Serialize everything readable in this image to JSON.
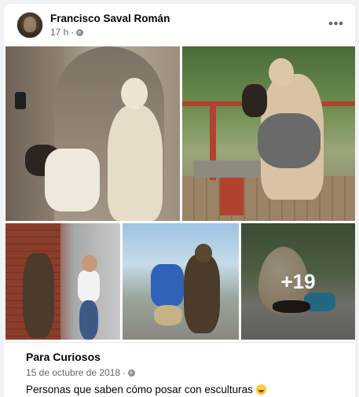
{
  "post": {
    "author": "Francisco Saval Román",
    "time": "17 h",
    "separator": "·",
    "more_label": "•••"
  },
  "photos": {
    "extra_count": "+19"
  },
  "link_preview": {
    "source": "Para Curiosos",
    "date": "15 de octubre de 2018",
    "separator": "·",
    "text": "Personas que saben cómo posar con esculturas",
    "emoji": "smiling-face-emoji"
  },
  "icons": {
    "globe": "globe-icon",
    "more": "more-options-icon"
  }
}
